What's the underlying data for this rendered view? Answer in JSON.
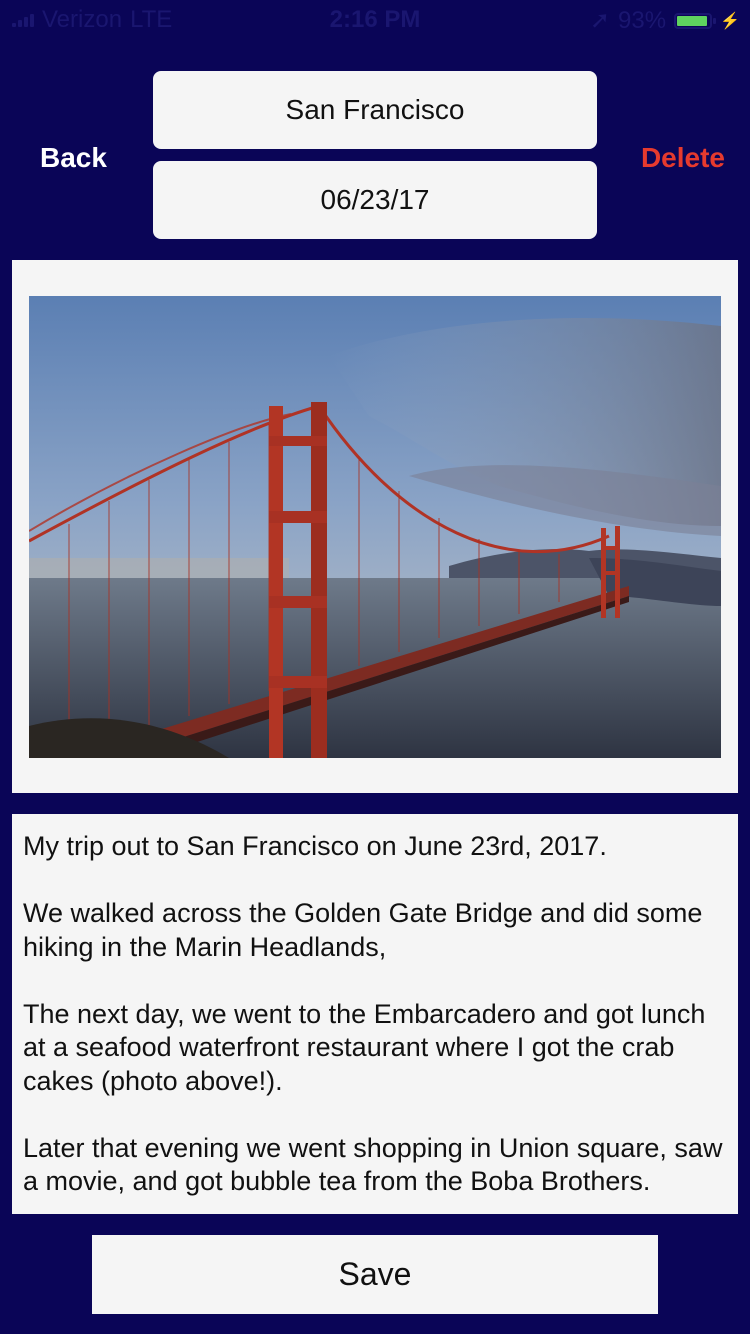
{
  "status_bar": {
    "carrier": "Verizon",
    "network": "LTE",
    "time": "2:16 PM",
    "battery": "93%",
    "battery_level": 0.93
  },
  "header": {
    "back_label": "Back",
    "delete_label": "Delete",
    "title_value": "San Francisco",
    "date_value": "06/23/17"
  },
  "photo": {
    "description_icon": "golden-gate-bridge-photo"
  },
  "journal": {
    "paragraphs": [
      "My trip out to San Francisco on June 23rd, 2017.",
      "We walked across the Golden Gate Bridge and did some hiking in the Marin Headlands,",
      "The next day, we went to the Embarcadero and got lunch at a seafood waterfront restaurant where I got the crab cakes (photo above!).",
      "Later that evening we went shopping in Union square, saw a movie, and got bubble tea from the Boba Brothers."
    ]
  },
  "footer": {
    "save_label": "Save"
  },
  "colors": {
    "background": "#0a0557",
    "delete": "#e63a2e",
    "panel": "#f5f5f5"
  }
}
